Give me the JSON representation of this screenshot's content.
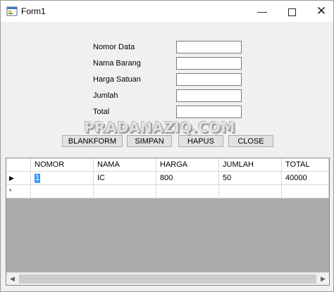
{
  "window": {
    "title": "Form1",
    "minimize": "—",
    "close": "✕"
  },
  "form": {
    "labels": {
      "nomor_data": "Nomor Data",
      "nama_barang": "Nama Barang",
      "harga_satuan": "Harga Satuan",
      "jumlah": "Jumlah",
      "total": "Total"
    },
    "values": {
      "nomor_data": "",
      "nama_barang": "",
      "harga_satuan": "",
      "jumlah": "",
      "total": ""
    }
  },
  "watermark": "PRADANAZIQ.COM",
  "buttons": {
    "blankform": "BLANKFORM",
    "simpan": "SIMPAN",
    "hapus": "HAPUS",
    "close": "CLOSE"
  },
  "grid": {
    "columns": [
      "NOMOR",
      "NAMA",
      "HARGA",
      "JUMLAH",
      "TOTAL"
    ],
    "rows": [
      {
        "indicator": "▶",
        "cells": [
          "1",
          "IC",
          "800",
          "50",
          "40000"
        ]
      }
    ],
    "new_row_indicator": "*"
  },
  "scrollbar": {
    "left_arrow": "◀",
    "right_arrow": "▶"
  },
  "colors": {
    "selection": "#3399ff",
    "grid_background": "#ababab",
    "form_background": "#f0f0f0"
  }
}
